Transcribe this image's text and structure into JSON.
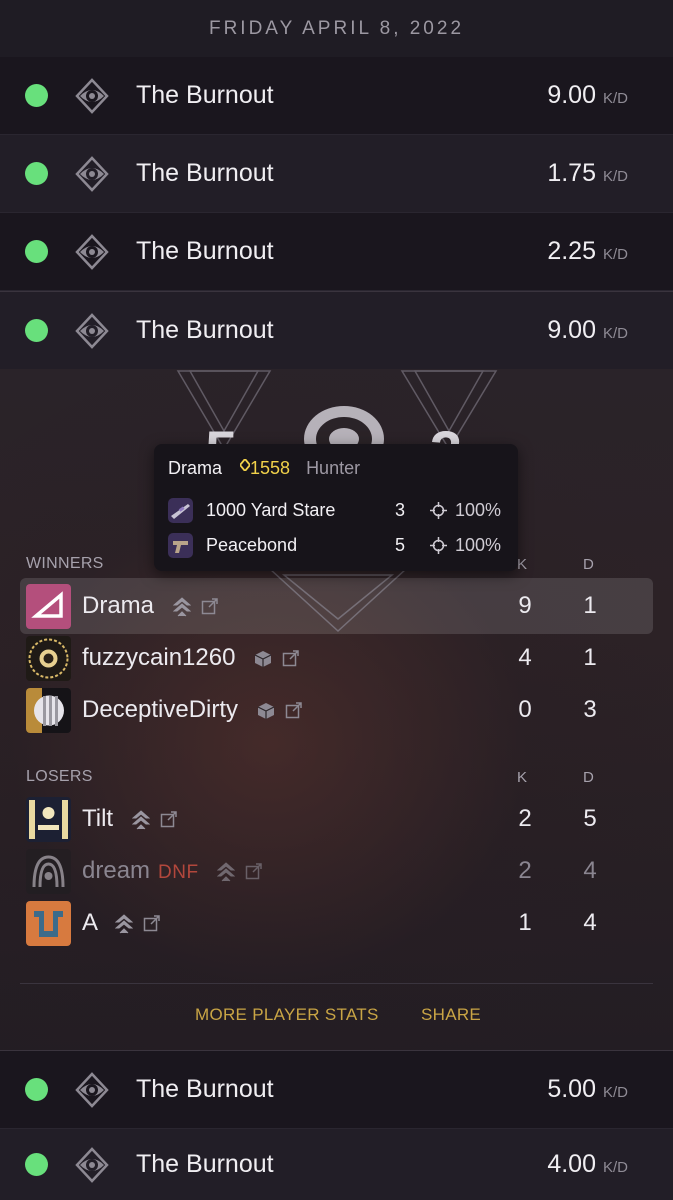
{
  "date_header": "FRIDAY APRIL 8, 2022",
  "colors": {
    "win_dot": "#68e07c",
    "accent_gold": "#c9a545",
    "power_yellow": "#f1d14a",
    "dnf_red": "#b2473c"
  },
  "matches_top": [
    {
      "name": "The Burnout",
      "kd": "9.00",
      "unit": "K/D",
      "result": "win",
      "icon": "eye-mode-icon"
    },
    {
      "name": "The Burnout",
      "kd": "1.75",
      "unit": "K/D",
      "result": "win",
      "icon": "eye-mode-icon"
    },
    {
      "name": "The Burnout",
      "kd": "2.25",
      "unit": "K/D",
      "result": "win",
      "icon": "eye-mode-icon"
    },
    {
      "name": "The Burnout",
      "kd": "9.00",
      "unit": "K/D",
      "result": "win",
      "icon": "eye-mode-icon"
    }
  ],
  "detail": {
    "score": {
      "left": "5",
      "right": "3"
    },
    "winners_label": "WINNERS",
    "losers_label": "LOSERS",
    "col_k": "K",
    "col_d": "D",
    "winners": [
      {
        "name": "Drama",
        "k": "9",
        "d": "1",
        "platform": "steam-icon",
        "highlight": true
      },
      {
        "name": "fuzzycain1260",
        "k": "4",
        "d": "1",
        "platform": "cube-icon"
      },
      {
        "name": "DeceptiveDirty",
        "k": "0",
        "d": "3",
        "platform": "cube-icon"
      }
    ],
    "losers": [
      {
        "name": "Tilt",
        "k": "2",
        "d": "5",
        "platform": "steam-icon"
      },
      {
        "name": "dream",
        "dnf": "DNF",
        "k": "2",
        "d": "4",
        "platform": "steam-icon",
        "dim": true
      },
      {
        "name": "A",
        "k": "1",
        "d": "4",
        "platform": "steam-icon"
      }
    ],
    "more_stats_label": "MORE PLAYER STATS",
    "share_label": "SHARE"
  },
  "tooltip": {
    "player": "Drama",
    "power": "1558",
    "power_icon": "power-diamond-icon",
    "class": "Hunter",
    "weapons": [
      {
        "name": "1000 Yard Stare",
        "kills": "3",
        "accuracy": "100%",
        "icon": "sniper-rifle-icon"
      },
      {
        "name": "Peacebond",
        "kills": "5",
        "accuracy": "100%",
        "icon": "sidearm-icon"
      }
    ]
  },
  "matches_bottom": [
    {
      "name": "The Burnout",
      "kd": "5.00",
      "unit": "K/D",
      "result": "win",
      "icon": "eye-mode-icon"
    },
    {
      "name": "The Burnout",
      "kd": "4.00",
      "unit": "K/D",
      "result": "win",
      "icon": "eye-mode-icon"
    }
  ]
}
